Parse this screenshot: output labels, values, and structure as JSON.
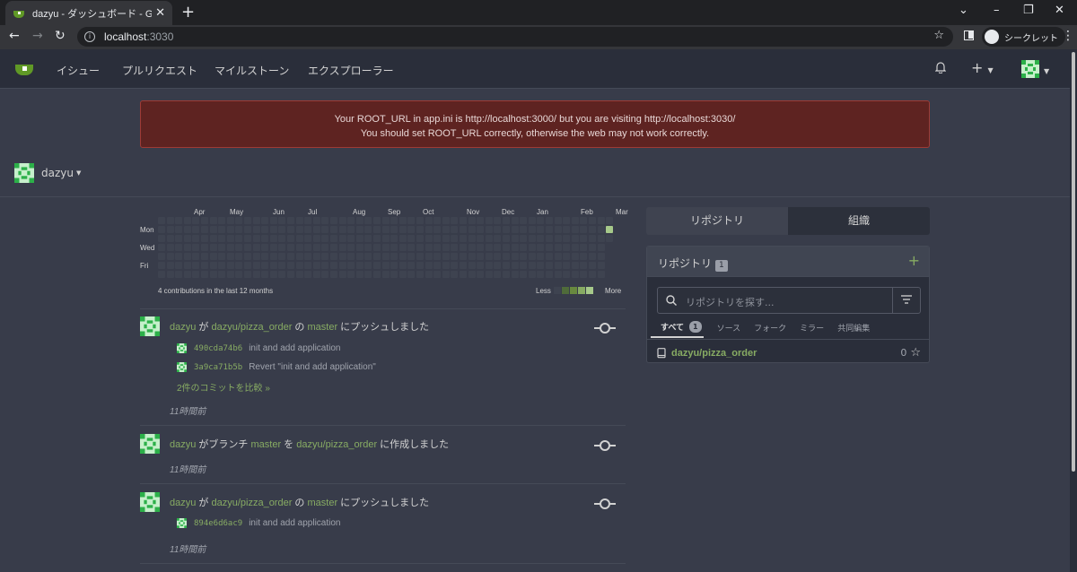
{
  "browser": {
    "tab_title": "dazyu - ダッシュボード - Gitea: Git with a cup of tea",
    "url_host": "localhost",
    "url_port": ":3030",
    "incognito_label": "シークレット"
  },
  "nav": {
    "items": [
      "イシュー",
      "プルリクエスト",
      "マイルストーン",
      "エクスプローラー"
    ]
  },
  "warning": {
    "line1": "Your ROOT_URL in app.ini is http://localhost:3000/ but you are visiting http://localhost:3030/",
    "line2": "You should set ROOT_URL correctly, otherwise the web may not work correctly."
  },
  "dashboard": {
    "username": "dazyu"
  },
  "heatmap": {
    "months": [
      "Apr",
      "May",
      "Jun",
      "Jul",
      "Aug",
      "Sep",
      "Oct",
      "Nov",
      "Dec",
      "Jan",
      "Feb",
      "Mar"
    ],
    "days": [
      "Mon",
      "Wed",
      "Fri"
    ],
    "summary": "4 contributions in the last 12 months",
    "less": "Less",
    "more": "More"
  },
  "feed": [
    {
      "user": "dazyu",
      "p1": " が ",
      "repo": "dazyu/pizza_order",
      "p2": " の ",
      "branch": "master",
      "p3": " にプッシュしました",
      "commits": [
        {
          "sha": "490cda74b6",
          "msg": "init and add application"
        },
        {
          "sha": "3a9ca71b5b",
          "msg": "Revert \"init and add application\""
        }
      ],
      "compare": "2件のコミットを比較 »",
      "time": "11時間前"
    },
    {
      "user": "dazyu",
      "p1": " がブランチ ",
      "branch": "master",
      "p2": " を ",
      "repo": "dazyu/pizza_order",
      "p3": " に作成しました",
      "time": "11時間前"
    },
    {
      "user": "dazyu",
      "p1": " が ",
      "repo": "dazyu/pizza_order",
      "p2": " の ",
      "branch": "master",
      "p3": " にプッシュしました",
      "commits": [
        {
          "sha": "894e6d6ac9",
          "msg": "init and add application"
        }
      ],
      "time": "11時間前"
    }
  ],
  "side": {
    "seg_repos": "リポジトリ",
    "seg_orgs": "組織",
    "header": "リポジトリ",
    "count": "1",
    "search_placeholder": "リポジトリを探す...",
    "tabs": [
      "すべて",
      "ソース",
      "フォーク",
      "ミラー",
      "共同編集"
    ],
    "all_count": "1",
    "repo": {
      "name": "dazyu/pizza_order",
      "stars": "0"
    }
  },
  "colors": {
    "accent": "#87ab63",
    "warning_bg": "#5e2321"
  }
}
